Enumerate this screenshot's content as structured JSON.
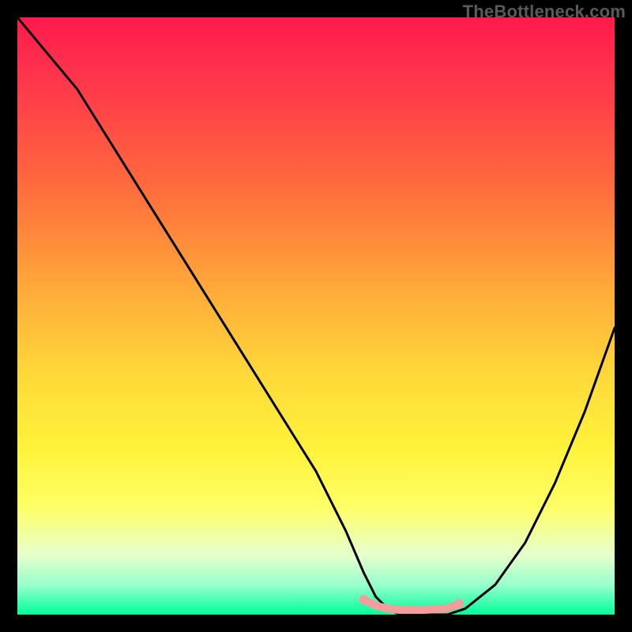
{
  "watermark": "TheBottleneck.com",
  "colors": {
    "frame": "#000000",
    "curve": "#000000",
    "highlight": "#f59d9c",
    "gradient_top": "#ff1a4d",
    "gradient_bottom": "#00ff99"
  },
  "chart_data": {
    "type": "line",
    "title": "",
    "xlabel": "",
    "ylabel": "",
    "xlim": [
      0,
      100
    ],
    "ylim": [
      0,
      100
    ],
    "grid": false,
    "legend": false,
    "annotations": [
      "TheBottleneck.com"
    ],
    "series": [
      {
        "name": "bottleneck-curve",
        "x": [
          0,
          5,
          10,
          15,
          20,
          25,
          30,
          35,
          40,
          45,
          50,
          55,
          58,
          60,
          62,
          64,
          66,
          68,
          70,
          72,
          75,
          80,
          85,
          90,
          95,
          100
        ],
        "y": [
          100,
          94,
          88,
          80,
          72,
          64,
          56,
          48,
          40,
          32,
          24,
          14,
          7,
          3,
          1,
          0,
          0,
          0,
          0,
          0,
          1,
          5,
          12,
          22,
          34,
          48
        ]
      },
      {
        "name": "optimal-range-highlight",
        "x": [
          58,
          60,
          62,
          64,
          66,
          68,
          70,
          72,
          74
        ],
        "y": [
          2.5,
          1.5,
          1,
          0.8,
          0.8,
          0.8,
          0.9,
          1,
          1.8
        ]
      }
    ]
  }
}
